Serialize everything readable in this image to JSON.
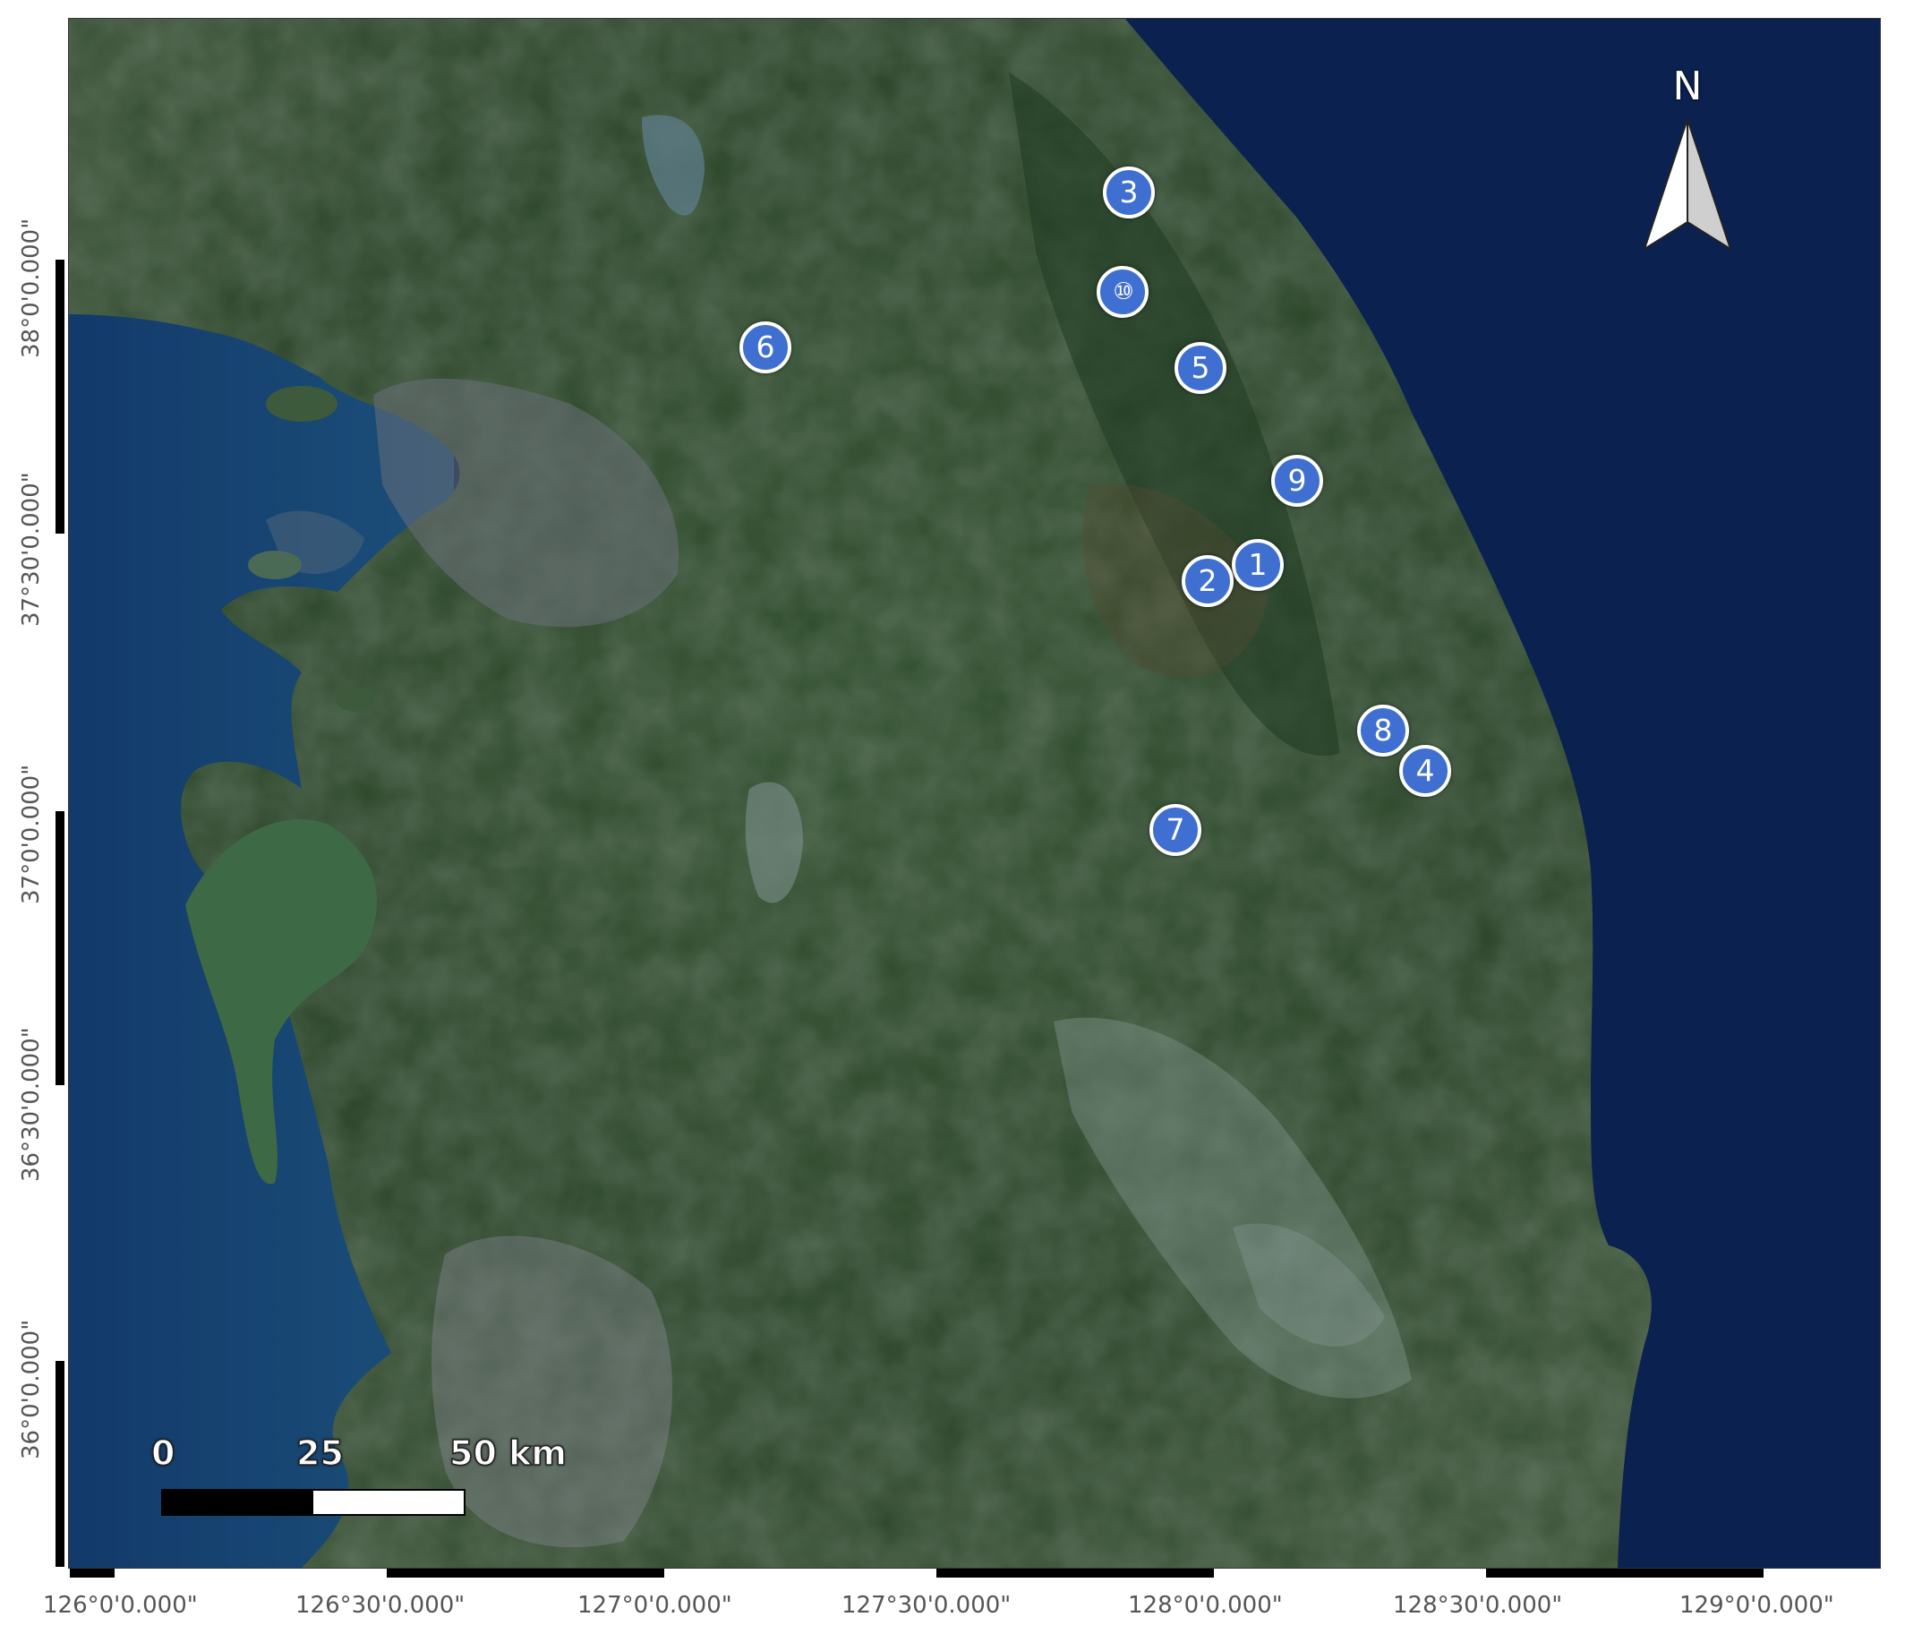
{
  "north_label": "N",
  "scale": {
    "labels": [
      "0",
      "25",
      "50 km"
    ]
  },
  "markers": [
    {
      "id": "3",
      "label": "3"
    },
    {
      "id": "10",
      "label": "⑩"
    },
    {
      "id": "6",
      "label": "6"
    },
    {
      "id": "5",
      "label": "5"
    },
    {
      "id": "9",
      "label": "9"
    },
    {
      "id": "1",
      "label": "1"
    },
    {
      "id": "2",
      "label": "2"
    },
    {
      "id": "8",
      "label": "8"
    },
    {
      "id": "4",
      "label": "4"
    },
    {
      "id": "7",
      "label": "7"
    }
  ],
  "longitude_labels": [
    "126°0'0.000\"",
    "126°30'0.000\"",
    "127°0'0.000\"",
    "127°30'0.000\"",
    "128°0'0.000\"",
    "128°30'0.000\"",
    "129°0'0.000\""
  ],
  "latitude_labels": [
    "38°0'0.000\"",
    "37°30'0.000\"",
    "37°0'0.000\"",
    "36°30'0.000\"",
    "36°0'0.000\""
  ],
  "colors": {
    "sea": "#0b2150",
    "land": "#2e4a2c",
    "marker_fill": "#3f6fd0",
    "marker_border": "#ffffff"
  }
}
